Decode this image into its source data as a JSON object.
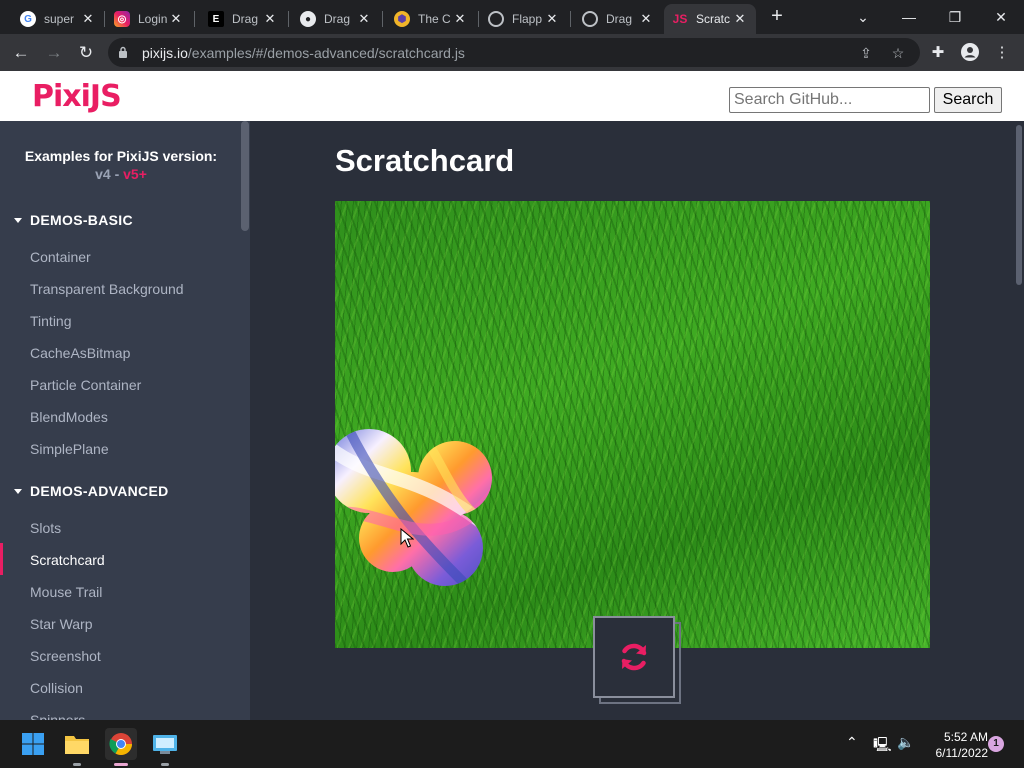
{
  "browser": {
    "tabs": [
      {
        "title": "super",
        "icon": "google-icon"
      },
      {
        "title": "Login",
        "icon": "instagram-icon"
      },
      {
        "title": "Drag",
        "icon": "e-icon"
      },
      {
        "title": "Drag",
        "icon": "github-icon"
      },
      {
        "title": "The C",
        "icon": "hexagon-icon"
      },
      {
        "title": "Flapp",
        "icon": "globe-icon"
      },
      {
        "title": "Drag",
        "icon": "globe-icon"
      },
      {
        "title": "Scratc",
        "icon": "pixijs-icon",
        "active": true
      }
    ],
    "url_host": "pixijs.io",
    "url_path": "/examples/#/demos-advanced/scratchcard.js"
  },
  "header": {
    "logo": "PixiJS",
    "search_placeholder": "Search GitHub...",
    "search_button": "Search"
  },
  "sidebar": {
    "heading": "Examples for PixiJS version:",
    "version_v4": "v4",
    "version_sep": "-",
    "version_v5": "v5+",
    "sections": [
      {
        "label": "DEMOS-BASIC",
        "items": [
          "Container",
          "Transparent Background",
          "Tinting",
          "CacheAsBitmap",
          "Particle Container",
          "BlendModes",
          "SimplePlane"
        ]
      },
      {
        "label": "DEMOS-ADVANCED",
        "items": [
          "Slots",
          "Scratchcard",
          "Mouse Trail",
          "Star Warp",
          "Screenshot",
          "Collision",
          "Spinners"
        ]
      }
    ],
    "active_item": "Scratchcard"
  },
  "main": {
    "title": "Scratchcard",
    "refresh_icon": "refresh-icon"
  },
  "taskbar": {
    "apps": [
      "windows-start-icon",
      "file-explorer-icon",
      "chrome-icon",
      "control-panel-icon"
    ],
    "time": "5:52 AM",
    "date": "6/11/2022",
    "notifications": "1"
  },
  "colors": {
    "accent": "#e91e63",
    "sidebar_bg": "#363d4c",
    "content_bg": "#2a2f3a"
  }
}
